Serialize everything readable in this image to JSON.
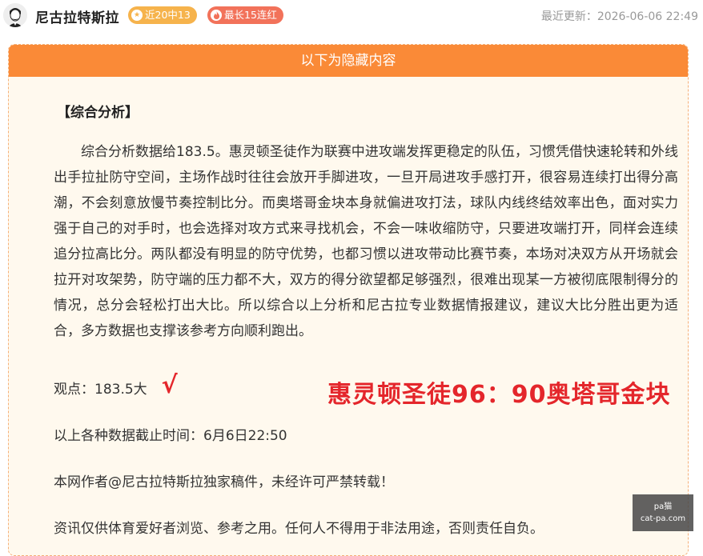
{
  "header": {
    "author": "尼古拉特斯拉",
    "badges": [
      {
        "label": "近20中13",
        "icon": "star-icon",
        "color": "#f6b34c"
      },
      {
        "label": "最长15连红",
        "icon": "flame-icon",
        "color": "#f2725a"
      }
    ],
    "updated": "最近更新：2026-06-06 22:49"
  },
  "card": {
    "bar_label": "以下为隐藏内容",
    "bar_color": "#fa8a37",
    "section_title": "【综合分析】",
    "analysis": "综合分析数据给183.5。惠灵顿圣徒作为联赛中进攻端发挥更稳定的队伍，习惯凭借快速轮转和外线出手拉扯防守空间，主场作战时往往会放开手脚进攻，一旦开局进攻手感打开，很容易连续打出得分高潮，不会刻意放慢节奏控制比分。而奥塔哥金块本身就偏进攻打法，球队内线终结效率出色，面对实力强于自己的对手时，也会选择对攻方式来寻找机会，不会一味收缩防守，只要进攻端打开，同样会连续追分拉高比分。两队都没有明显的防守优势，也都习惯以进攻带动比赛节奏，本场对决双方从开场就会拉开对攻架势，防守端的压力都不大，双方的得分欲望都足够强烈，很难出现某一方被彻底限制得分的情况，总分会轻松打出大比。所以综合以上分析和尼古拉专业数据情报建议，建议大比分胜出更为适合，多方数据也支撑该参考方向顺利跑出。",
    "opinion": "观点：183.5大",
    "tick": "√",
    "result": "惠灵顿圣徒96：90奥塔哥金块",
    "result_color": "#e4262b",
    "cutoff": "以上各种数据截止时间：6月6日22:50",
    "copyright": "本网作者@尼古拉特斯拉独家稿件，未经许可严禁转载！",
    "disclaimer": "资讯仅供体育爱好者浏览、参考之用。任何人不得用于非法用途，否则责任自负。"
  },
  "watermark": {
    "line1": "pa猫",
    "line2": "cat-pa.com"
  }
}
